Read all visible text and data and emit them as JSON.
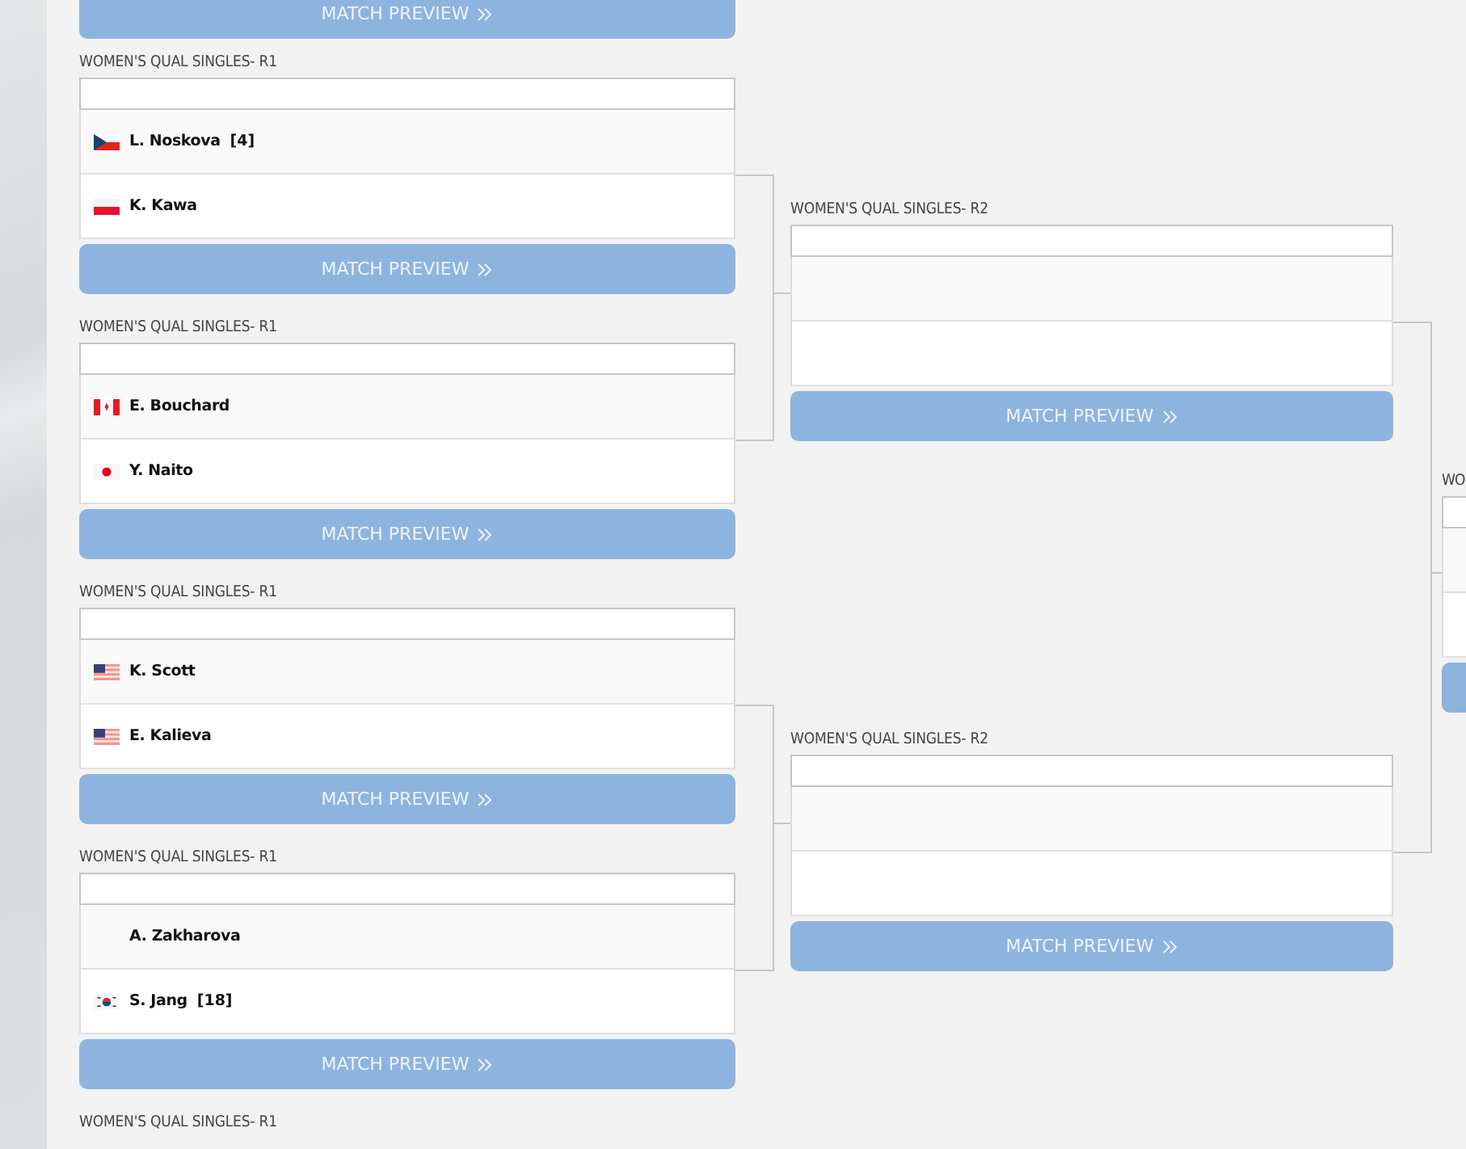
{
  "top_button": {
    "label": "MATCH PREVIEW"
  },
  "rounds": [
    {
      "matches": [
        {
          "title": "WOMEN'S QUAL SINGLES- R1",
          "players": [
            {
              "name": "L. Noskova",
              "seed": "[4]",
              "kind": "cz"
            },
            {
              "name": "K. Kawa",
              "kind": "pl"
            }
          ],
          "button": {
            "label": "MATCH PREVIEW"
          }
        },
        {
          "title": "WOMEN'S QUAL SINGLES- R1",
          "players": [
            {
              "name": "E. Bouchard",
              "kind": "ca"
            },
            {
              "name": "Y. Naito",
              "kind": "jp"
            }
          ],
          "button": {
            "label": "MATCH PREVIEW"
          }
        },
        {
          "title": "WOMEN'S QUAL SINGLES- R1",
          "players": [
            {
              "name": "K. Scott",
              "kind": "us"
            },
            {
              "name": "E. Kalieva",
              "kind": "us"
            }
          ],
          "button": {
            "label": "MATCH PREVIEW"
          }
        },
        {
          "title": "WOMEN'S QUAL SINGLES- R1",
          "players": [
            {
              "name": "A. Zakharova",
              "kind": "none"
            },
            {
              "name": "S. Jang",
              "seed": "[18]",
              "kind": "kr"
            }
          ],
          "button": {
            "label": "MATCH PREVIEW"
          }
        },
        {
          "title": "WOMEN'S QUAL SINGLES- R1"
        }
      ]
    },
    {
      "matches": [
        {
          "title": "WOMEN'S QUAL SINGLES- R2",
          "players": [
            {
              "kind": "empty"
            },
            {
              "kind": "empty"
            }
          ],
          "button": {
            "label": "MATCH PREVIEW"
          }
        },
        {
          "title": "WOMEN'S QUAL SINGLES- R2",
          "players": [
            {
              "kind": "empty"
            },
            {
              "kind": "empty"
            }
          ],
          "button": {
            "label": "MATCH PREVIEW"
          }
        }
      ]
    },
    {
      "matches": [
        {
          "title": "WO",
          "players": [
            {
              "kind": "empty"
            },
            {
              "kind": "empty"
            }
          ]
        }
      ]
    }
  ]
}
